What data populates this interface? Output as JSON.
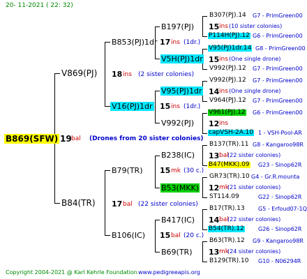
{
  "header": {
    "date": "20- 11-2021 ( 22: 32)"
  },
  "footer": {
    "copyright": "Copyright 2004-2021 @ Karl Kehrle Foundation",
    "site": "www.pedigreeapis.org"
  },
  "colors": {
    "cyan": "#00e8ff",
    "green": "#00d000",
    "yellow": "#ffff00",
    "ins": "#cc0000",
    "blue": "#0000cc"
  },
  "root": {
    "name": "B869(SFW)",
    "num": "19",
    "ins": "bal",
    "note": "(Drones from 20 sister colonies)"
  },
  "gen1": [
    {
      "name": "V869(PJ)",
      "num": "18",
      "ins": "ins",
      "note": "(2 sister colonies)"
    },
    {
      "name": "B84(TR)",
      "num": "17",
      "ins": "bal",
      "note": "(22 sister colonies)"
    }
  ],
  "gen2": [
    {
      "name": "B853(PJ)1dr",
      "num": "17",
      "ins": "ins",
      "note": "(1dr.)"
    },
    {
      "name": "V16(PJ)1dr",
      "num": "15",
      "ins": "ins",
      "note": "(1dr.)"
    },
    {
      "name": "B79(TR)",
      "num": "15",
      "ins": "mk",
      "note": "(30 c.)"
    },
    {
      "name": "B106(IC)",
      "num": "15",
      "ins": "bal",
      "note": "(20 c.)"
    }
  ],
  "gen3": [
    {
      "name": "B197(PJ)",
      "num": "",
      "ins": "",
      "note": ""
    },
    {
      "name": "V5H(PJ)1dr",
      "num": "",
      "ins": "",
      "note": ""
    },
    {
      "name": "V95(PJ)1dr",
      "num": "",
      "ins": "",
      "note": ""
    },
    {
      "name": "V992(PJ)",
      "num": "",
      "ins": "",
      "note": ""
    },
    {
      "name": "B238(IC)",
      "num": "",
      "ins": "",
      "note": ""
    },
    {
      "name": "B53(MKK)",
      "num": "",
      "ins": "",
      "note": ""
    },
    {
      "name": "B417(IC)",
      "num": "",
      "ins": "",
      "note": ""
    },
    {
      "name": "B69(TR)",
      "num": "",
      "ins": "",
      "note": ""
    }
  ],
  "gen4": [
    {
      "name": "B307(PJ).14",
      "desc": "G7 - PrimGreen00"
    },
    {
      "num": "15",
      "ins": "ins",
      "note": "(10 sister colonies)"
    },
    {
      "name": "P114H(PJ).12",
      "desc": "G6 - PrimGreen00"
    },
    {
      "name": "V95(PJ)1dr.14",
      "desc": "G8 - PrimGreen00"
    },
    {
      "num": "15",
      "ins": "ins",
      "note": "(One single drone)"
    },
    {
      "name": "V992(PJ).12",
      "desc": "G7 - PrimGreen00"
    },
    {
      "name": "V992(PJ).12",
      "desc": "G7 - PrimGreen00"
    },
    {
      "num": "14",
      "ins": "ins",
      "note": "(One single drone)"
    },
    {
      "name": "V964(PJ).12",
      "desc": "G7 - PrimGreen00"
    },
    {
      "name": "V961(PJ).12",
      "desc": "G6 - PrimGreen00"
    },
    {
      "num": "12",
      "ins": "ins",
      "note": ""
    },
    {
      "name": "capVSH-2A.10",
      "desc": "1 - VSH-Pool-AR"
    },
    {
      "name": "B137(TR).11",
      "desc": "G8 - Kangaroo98R"
    },
    {
      "num": "13",
      "ins": "bal",
      "note": "(22 sister colonies)"
    },
    {
      "name": "B47(MKK).09",
      "desc": "G23 - Sinop62R"
    },
    {
      "name": "GR73(TR).10",
      "desc": "G4 - Gr.R.mounta"
    },
    {
      "num": "12",
      "ins": "mk",
      "note": "(21 sister colonies)"
    },
    {
      "name": "ST114.09",
      "desc": "G22 - Sinop62R"
    },
    {
      "name": "B17(TR).13",
      "desc": "G5 - Erfoud07-1Q"
    },
    {
      "num": "14",
      "ins": "bal",
      "note": "(22 sister colonies)"
    },
    {
      "name": "B54(TR).12",
      "desc": "G26 - Sinop62R"
    },
    {
      "name": "B63(TR).12",
      "desc": "G9 - Kangaroo98R"
    },
    {
      "num": "13",
      "ins": "mk",
      "note": "(24 sister colonies)"
    },
    {
      "name": "B129(TR).10",
      "desc": "G10 - N06294R"
    }
  ]
}
